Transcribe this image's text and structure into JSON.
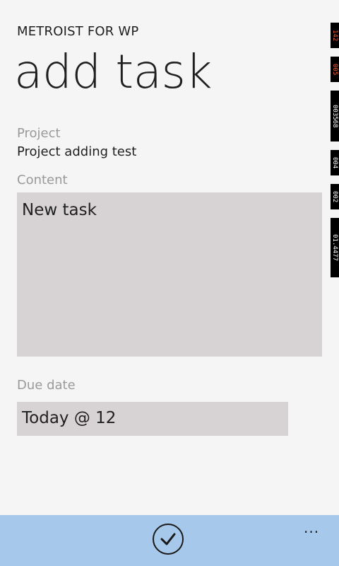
{
  "header": {
    "app_title": "METROIST FOR WP",
    "page_title": "add task"
  },
  "form": {
    "project": {
      "label": "Project",
      "value": "Project adding test"
    },
    "content": {
      "label": "Content",
      "value": "New task"
    },
    "due_date": {
      "label": "Due date",
      "value": "Today @ 12"
    }
  },
  "debug_counters": [
    {
      "text": "142",
      "color": "#ff5a2a"
    },
    {
      "text": "005",
      "color": "#ff5a2a"
    },
    {
      "text": "003568",
      "color": "#ffffff"
    },
    {
      "text": "004",
      "color": "#ffffff"
    },
    {
      "text": "002",
      "color": "#ffffff"
    },
    {
      "text": "01.4477",
      "color": "#ffffff"
    }
  ],
  "app_bar": {
    "primary_icon": "check-icon",
    "more_label": "..."
  }
}
